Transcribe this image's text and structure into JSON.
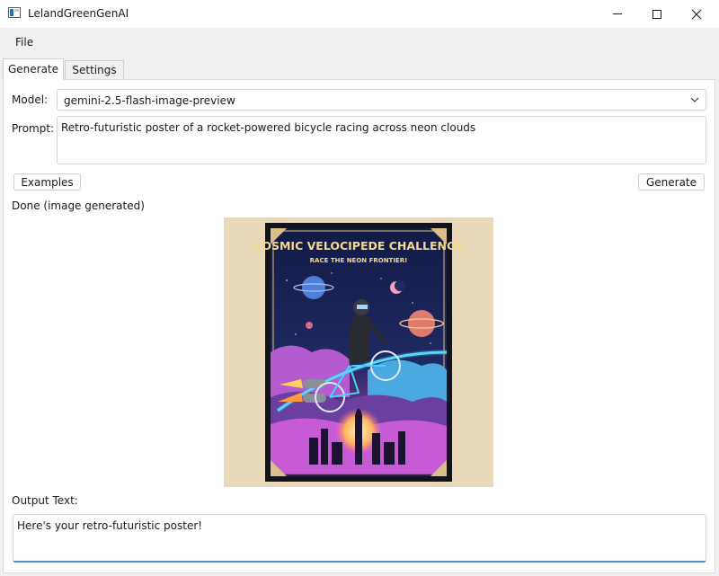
{
  "window": {
    "title": "LelandGreenGenAI"
  },
  "menu": {
    "file": "File"
  },
  "tabs": [
    {
      "label": "Generate",
      "active": true
    },
    {
      "label": "Settings",
      "active": false
    }
  ],
  "generate": {
    "model_label": "Model:",
    "model_value": "gemini-2.5-flash-image-preview",
    "prompt_label": "Prompt:",
    "prompt_value": "Retro-futuristic poster of a rocket-powered bicycle racing across neon clouds",
    "examples_button": "Examples",
    "generate_button": "Generate",
    "status": "Done (image generated)",
    "output_label": "Output Text:",
    "output_value": "Here's your retro-futuristic poster!"
  },
  "poster": {
    "title": "COSMIC VELOCIPEDE CHALLENGE",
    "subtitle": "RACE THE NEON FRONTIER!"
  },
  "colors": {
    "accent": "#4a8fd8",
    "poster_bg": "#1c2552",
    "poster_title": "#f5d98b",
    "neon_cloud": "#c75bd6"
  }
}
